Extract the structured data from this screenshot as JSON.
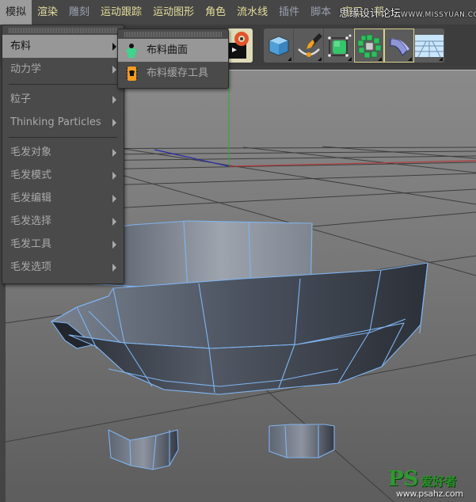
{
  "menubar": {
    "items": [
      {
        "label": "模拟",
        "state": "active"
      },
      {
        "label": "渲染",
        "state": "normal"
      },
      {
        "label": "雕刻",
        "state": "dim"
      },
      {
        "label": "运动跟踪",
        "state": "normal"
      },
      {
        "label": "运动图形",
        "state": "normal"
      },
      {
        "label": "角色",
        "state": "normal"
      },
      {
        "label": "流水线",
        "state": "normal"
      },
      {
        "label": "插件",
        "state": "dim"
      },
      {
        "label": "脚本",
        "state": "dim"
      },
      {
        "label": "窗口",
        "state": "normal"
      },
      {
        "label": "帮",
        "state": "normal"
      }
    ]
  },
  "watermark_top": {
    "text": "思缘设计论坛",
    "url": "WWW.MISSYUAN.COM"
  },
  "toolbar": {
    "tools": [
      {
        "icon": "render-settings-icon"
      },
      {
        "icon": "cube-primitive-icon"
      },
      {
        "icon": "pen-spline-icon"
      },
      {
        "icon": "subdivision-surface-icon"
      },
      {
        "icon": "cloner-icon",
        "selected": true
      },
      {
        "icon": "bend-deformer-icon",
        "selected": true
      },
      {
        "icon": "floor-scene-icon"
      }
    ]
  },
  "simulate_menu": {
    "items": [
      {
        "label": "布料",
        "highlighted": true,
        "submenu": true
      },
      {
        "label": "动力学",
        "submenu": true
      },
      {
        "separator": true
      },
      {
        "label": "粒子",
        "submenu": true
      },
      {
        "label": "Thinking Particles",
        "submenu": true
      },
      {
        "separator": true
      },
      {
        "label": "毛发对象",
        "submenu": true
      },
      {
        "label": "毛发模式",
        "submenu": true
      },
      {
        "label": "毛发编辑",
        "submenu": true
      },
      {
        "label": "毛发选择",
        "submenu": true
      },
      {
        "label": "毛发工具",
        "submenu": true
      },
      {
        "label": "毛发选项",
        "submenu": true
      }
    ]
  },
  "cloth_submenu": {
    "items": [
      {
        "label": "布料曲面",
        "icon": "cloth-surface-icon",
        "highlighted": true
      },
      {
        "label": "布料缓存工具",
        "icon": "cloth-cache-tool-icon"
      }
    ]
  },
  "viewport": {
    "object": "low-poly bowl with four legs",
    "axis_colors": {
      "x": "#b83a3a",
      "y": "#3fa23f",
      "z": "#2a2aa8"
    },
    "wire_color": "#7fb4f0"
  },
  "watermark_bottom": {
    "brand": "PS",
    "cn": "爱好者",
    "url": "www.psahz.com"
  }
}
